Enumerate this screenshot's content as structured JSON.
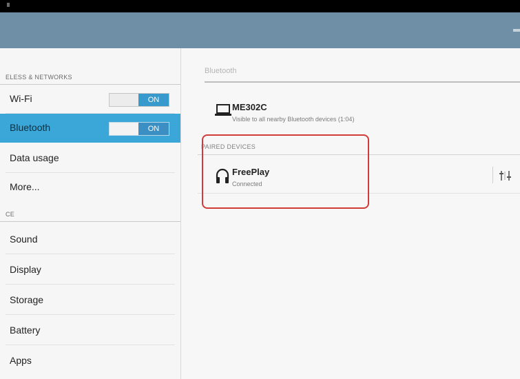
{
  "sidebar": {
    "section_wireless": "ELESS & NETWORKS",
    "section_device": "CE",
    "items": [
      {
        "label": "Wi-Fi",
        "toggle": "ON"
      },
      {
        "label": "Bluetooth",
        "toggle": "ON"
      },
      {
        "label": "Data usage"
      },
      {
        "label": "More..."
      },
      {
        "label": "Sound"
      },
      {
        "label": "Display"
      },
      {
        "label": "Storage"
      },
      {
        "label": "Battery"
      },
      {
        "label": "Apps"
      }
    ]
  },
  "content": {
    "title": "Bluetooth",
    "this_device": {
      "name": "ME302C",
      "subtitle": "Visible to all nearby Bluetooth devices (1:04)",
      "icon": "laptop-icon"
    },
    "paired_header": "PAIRED DEVICES",
    "paired": [
      {
        "name": "FreePlay",
        "status": "Connected",
        "icon": "headphones-icon"
      }
    ]
  },
  "colors": {
    "actionbar": "#6f8fa6",
    "selected_item": "#3aa7d8",
    "toggle_on": "#3799cc",
    "highlight_border": "#d23a3a"
  }
}
